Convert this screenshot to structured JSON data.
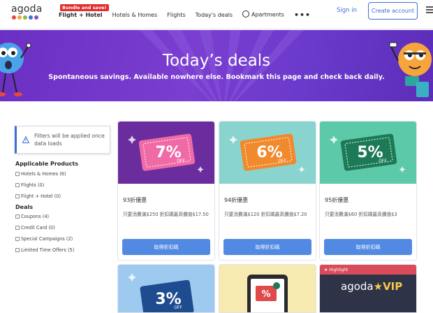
{
  "header": {
    "logo": "agoda",
    "logo_colors": [
      "#e8493f",
      "#f7a43c",
      "#83bf3f",
      "#3b6fd4",
      "#8b4ec6"
    ],
    "nav": {
      "badge": "Bundle and save!",
      "flight_hotel": "Flight + Hotel",
      "hotels_homes": "Hotels & Homes",
      "flights": "Flights",
      "todays_deals": "Today's deals",
      "apartments": "Apartments",
      "more": "•••"
    },
    "sign_in": "Sign in",
    "create_account": "Create account"
  },
  "banner": {
    "title": "Today’s deals",
    "subtitle": "Spontaneous savings. Available nowhere else. Bookmark this page and check back daily."
  },
  "sidebar": {
    "notice": "Filters will be applied once data loads",
    "applicable_products_heading": "Applicable Products",
    "products": [
      "Hotels & Homes (6)",
      "Flights (0)",
      "Flight + Hotel (0)"
    ],
    "deals_heading": "Deals",
    "deals": [
      "Coupons (4)",
      "Credit Card (0)",
      "Special Campaigns (2)",
      "Limited Time Offers (5)"
    ]
  },
  "cards": [
    {
      "percent": "7%",
      "off": "OFF",
      "title": "93折優惠",
      "desc": "只要消費滿$250 折扣碼最高價值$17.50",
      "button": "取得折扣碼",
      "bg": "#6b2d9e",
      "ticket": "#f06aa6"
    },
    {
      "percent": "6%",
      "off": "OFF",
      "title": "94折優惠",
      "desc": "只要消費滿$120 折扣碼最高價值$7.20",
      "button": "取得折扣碼",
      "bg": "#8ad4d0",
      "ticket": "#f18a2c"
    },
    {
      "percent": "5%",
      "off": "OFF",
      "title": "95折優惠",
      "desc": "只要消費滿$60 折扣碼最高價值$3",
      "button": "取得折扣碼",
      "bg": "#5cc9a8",
      "ticket": "#1c7a56"
    }
  ],
  "bottom_cards": [
    {
      "percent": "3%",
      "off": "OFF",
      "bg": "#9fcaf0",
      "ticket": "#1e4c8f"
    },
    {
      "percent": "%",
      "bg": "#f7eab0",
      "ticket": "#e04a4a"
    },
    {
      "highlight": "Highlight",
      "brand": "agoda",
      "vip": "VIP",
      "bg": "#2e3348",
      "tag_bg": "#d94a5a"
    }
  ]
}
